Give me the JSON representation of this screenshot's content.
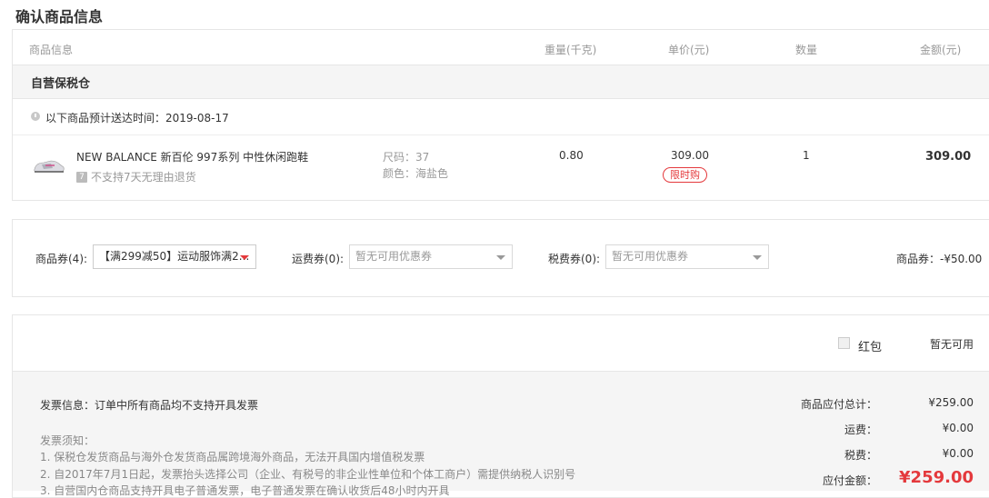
{
  "title": "确认商品信息",
  "table_header": {
    "info": "商品信息",
    "weight": "重量(千克)",
    "unit_price": "单价(元)",
    "quantity": "数量",
    "amount": "金额(元)"
  },
  "warehouse": "自营保税仓",
  "delivery_text": "以下商品预计送达时间：2019-08-17",
  "product": {
    "name": "NEW BALANCE 新百伦 997系列 中性休闲跑鞋",
    "return_tag": "7",
    "return_note": "不支持7天无理由退货",
    "size": "尺码：37",
    "color": "颜色：海盐色",
    "weight": "0.80",
    "unit_price": "309.00",
    "limit_tag": "限时购",
    "quantity": "1",
    "amount": "309.00"
  },
  "coupons": {
    "goods_label": "商品券(4):",
    "goods_value": "【满299减50】运动服饰满2...",
    "shipping_label": "运费券(0):",
    "shipping_value": "暂无可用优惠券",
    "tax_label": "税费券(0):",
    "tax_value": "暂无可用优惠券",
    "summary": "商品券：-¥50.00"
  },
  "red_packet": {
    "label": "红包",
    "status": "暂无可用"
  },
  "invoice": {
    "info": "发票信息：订单中所有商品均不支持开具发票",
    "notice_title": "发票须知：",
    "notice_1": "1. 保税仓发货商品与海外仓发货商品属跨境海外商品，无法开具国内增值税发票",
    "notice_2": "2. 自2017年7月1日起，发票抬头选择公司（企业、有税号的非企业性单位和个体工商户）需提供纳税人识别号",
    "notice_3": "3. 自营国内仓商品支持开具电子普通发票，电子普通发票在确认收货后48小时内开具"
  },
  "summary": {
    "goods_total_label": "商品应付总计：",
    "goods_total": "¥259.00",
    "shipping_label": "运费：",
    "shipping": "¥0.00",
    "tax_label": "税费：",
    "tax": "¥0.00",
    "payable_label": "应付金额：",
    "payable": "¥259.00"
  },
  "colors": {
    "accent": "#e4393c",
    "border": "#e6e6e6",
    "band": "#f5f5f5"
  }
}
